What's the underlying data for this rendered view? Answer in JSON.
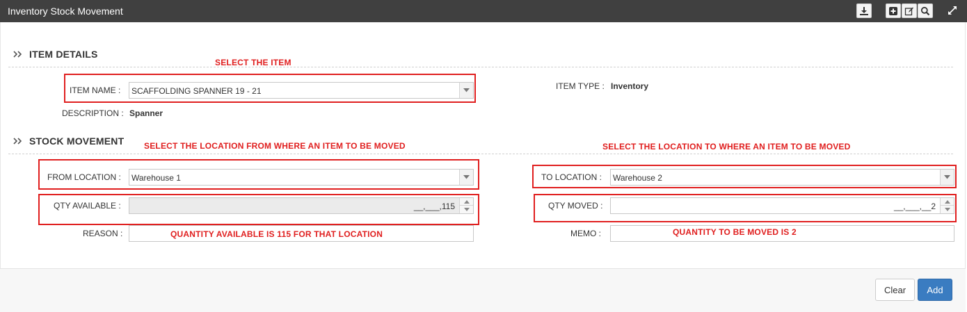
{
  "window": {
    "title": "Inventory Stock Movement"
  },
  "toolbar": {
    "download_icon": "download-icon",
    "add_icon": "plus-square-icon",
    "edit_icon": "edit-icon",
    "search_icon": "search-icon",
    "expand_icon": "expand-icon"
  },
  "item_details": {
    "heading": "ITEM DETAILS",
    "item_name_label": "ITEM NAME :",
    "item_name_value": "SCAFFOLDING SPANNER 19 - 21",
    "item_type_label": "ITEM TYPE :",
    "item_type_value": "Inventory",
    "description_label": "DESCRIPTION :",
    "description_value": "Spanner"
  },
  "stock_movement": {
    "heading": "STOCK MOVEMENT",
    "from_location_label": "FROM LOCATION :",
    "from_location_value": "Warehouse 1",
    "to_location_label": "TO LOCATION :",
    "to_location_value": "Warehouse 2",
    "qty_available_label": "QTY AVAILABLE :",
    "qty_available_value": "__,___,115",
    "qty_moved_label": "QTY MOVED :",
    "qty_moved_value": "__,___,__2",
    "reason_label": "REASON :",
    "reason_value": "",
    "memo_label": "MEMO :",
    "memo_value": ""
  },
  "annotations": {
    "select_item": "SELECT THE ITEM",
    "select_from": "SELECT THE LOCATION FROM WHERE AN ITEM TO BE MOVED",
    "select_to": "SELECT THE LOCATION TO WHERE AN ITEM TO BE MOVED",
    "qty_available_note": "QUANTITY AVAILABLE IS 115 FOR THAT LOCATION",
    "qty_moved_note": "QUANTITY TO BE MOVED IS 2"
  },
  "footer": {
    "clear_label": "Clear",
    "add_label": "Add"
  },
  "colors": {
    "titlebar": "#404040",
    "annotation_red": "#e01e1e",
    "primary_button": "#3a7cc1"
  }
}
